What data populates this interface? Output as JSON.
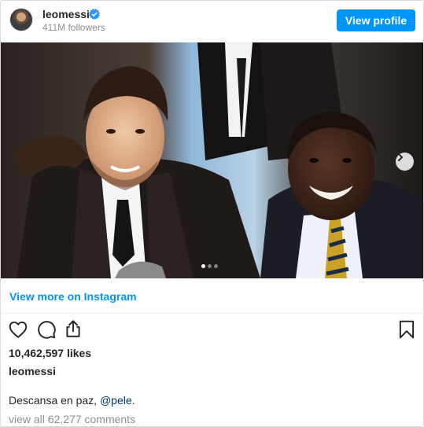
{
  "header": {
    "username": "leomessi",
    "verified": true,
    "followers": "411M followers",
    "view_profile_label": "View profile"
  },
  "post": {
    "carousel": {
      "slide_count": 3,
      "active_slide": 1
    },
    "view_more_label": "View more on Instagram",
    "likes": "10,462,597 likes",
    "caption_username": "leomessi",
    "caption_text": "Descansa en paz, ",
    "caption_mention": "@pele",
    "caption_end": ".",
    "comments_link": "view all 62,277 comments"
  },
  "icons": {
    "like": "heart-icon",
    "comment": "comment-icon",
    "share": "share-icon",
    "save": "bookmark-icon",
    "next": "chevron-right-icon",
    "verified": "verified-badge-icon"
  },
  "colors": {
    "accent": "#0095f6",
    "mention": "#00376b",
    "muted": "#8e8e8e",
    "text": "#262626",
    "verified": "#3897f0"
  }
}
